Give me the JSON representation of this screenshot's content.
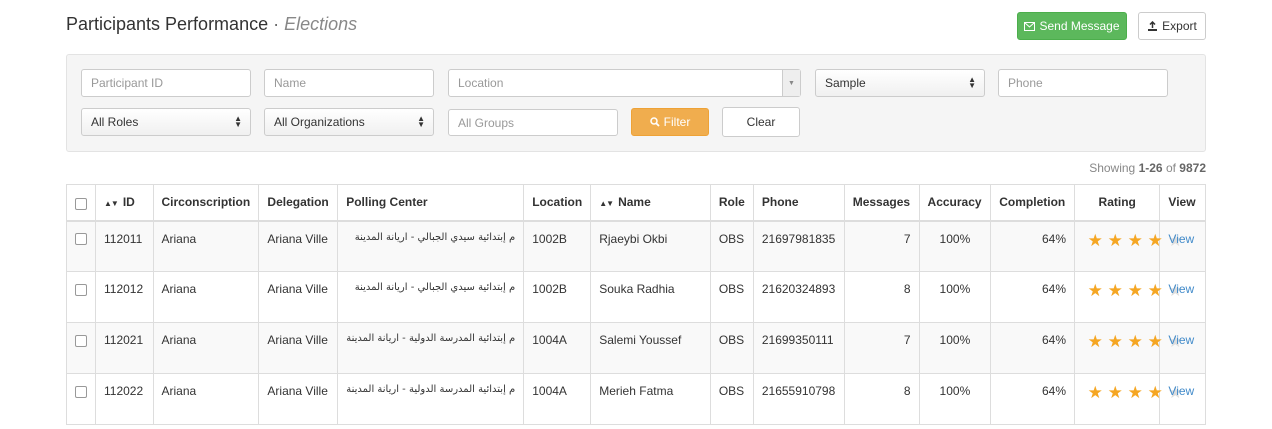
{
  "header": {
    "title": "Participants Performance",
    "separator": "·",
    "subtitle": "Elections",
    "send_message_label": "Send Message",
    "export_label": "Export",
    "send_color": "#5cb85c"
  },
  "filters": {
    "participant_id_placeholder": "Participant ID",
    "name_placeholder": "Name",
    "location_placeholder": "Location",
    "sample_value": "Sample",
    "phone_placeholder": "Phone",
    "roles_value": "All Roles",
    "organizations_value": "All Organizations",
    "groups_placeholder": "All Groups",
    "filter_label": "Filter",
    "clear_label": "Clear",
    "filter_color": "#f0ad4e"
  },
  "showing": {
    "prefix": "Showing",
    "range": "1-26",
    "of": "of",
    "total": "9872"
  },
  "table": {
    "columns": [
      "ID",
      "Circonscription",
      "Delegation",
      "Polling Center",
      "Location",
      "Name",
      "Role",
      "Phone",
      "Messages",
      "Accuracy",
      "Completion",
      "Rating",
      "View"
    ],
    "rows": [
      {
        "id": "112011",
        "circ": "Ariana",
        "deleg": "Ariana Ville",
        "center": "م إبتدائية سيدي الجبالي - اريانة المدينة",
        "location": "1002B",
        "name": "Rjaeybi Okbi",
        "role": "OBS",
        "phone": "21697981835",
        "messages": "7",
        "accuracy": "100%",
        "completion": "64%",
        "rating": 4,
        "view": "View"
      },
      {
        "id": "112012",
        "circ": "Ariana",
        "deleg": "Ariana Ville",
        "center": "م إبتدائية سيدي الجبالي - اريانة المدينة",
        "location": "1002B",
        "name": "Souka Radhia",
        "role": "OBS",
        "phone": "21620324893",
        "messages": "8",
        "accuracy": "100%",
        "completion": "64%",
        "rating": 4,
        "view": "View"
      },
      {
        "id": "112021",
        "circ": "Ariana",
        "deleg": "Ariana Ville",
        "center": "م إبتدائية المدرسة الدولية - اريانة المدينة",
        "location": "1004A",
        "name": "Salemi Youssef",
        "role": "OBS",
        "phone": "21699350111",
        "messages": "7",
        "accuracy": "100%",
        "completion": "64%",
        "rating": 4,
        "view": "View"
      },
      {
        "id": "112022",
        "circ": "Ariana",
        "deleg": "Ariana Ville",
        "center": "م إبتدائية المدرسة الدولية - اريانة المدينة",
        "location": "1004A",
        "name": "Merieh Fatma",
        "role": "OBS",
        "phone": "21655910798",
        "messages": "8",
        "accuracy": "100%",
        "completion": "64%",
        "rating": 4,
        "view": "View"
      }
    ],
    "rating_max": 5,
    "star_color": "#f5a623",
    "link_color": "#428bca"
  }
}
